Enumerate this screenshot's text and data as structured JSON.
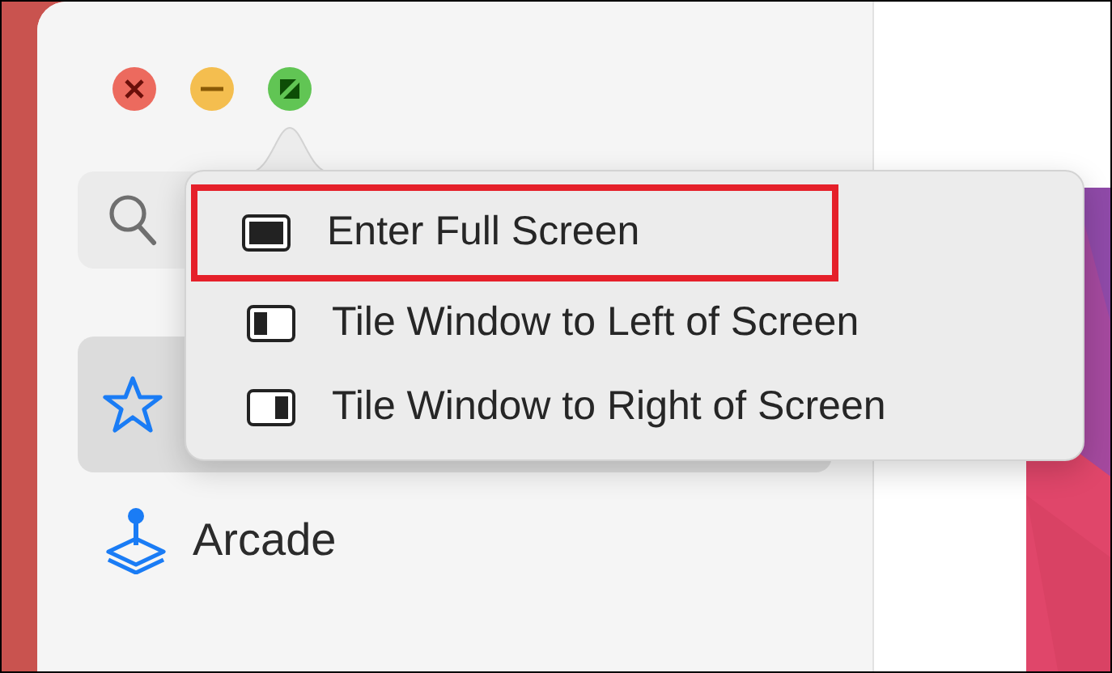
{
  "sidebar": {
    "items": [
      {
        "kind": "star",
        "selected": true
      },
      {
        "kind": "arcade",
        "label": "Arcade",
        "selected": false
      }
    ]
  },
  "zoom_menu": {
    "items": [
      {
        "kind": "full",
        "label": "Enter Full Screen",
        "outlined": true
      },
      {
        "kind": "left",
        "label": "Tile Window to Left of Screen",
        "outlined": false
      },
      {
        "kind": "right",
        "label": "Tile Window to Right of Screen",
        "outlined": false
      }
    ]
  }
}
